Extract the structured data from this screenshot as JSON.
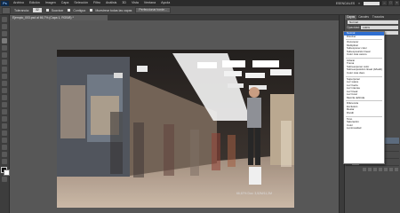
{
  "app": {
    "logo": "Ps"
  },
  "menu": [
    "Archivo",
    "Edición",
    "Imagen",
    "Capa",
    "Selección",
    "Filtro",
    "Análisis",
    "3D",
    "Vista",
    "Ventana",
    "Ayuda"
  ],
  "workspace": {
    "label": "ESENCIALES",
    "more": "»"
  },
  "window_buttons": [
    "–",
    "□",
    "×"
  ],
  "options": {
    "tolerance_label": "Tolerancia:",
    "tolerance_value": "32",
    "antialias_label": "Suavizar",
    "contiguous_label": "Contiguo",
    "all_layers_label": "Muestrear todas las capas",
    "refine_label": "Perfeccionar borde..."
  },
  "document": {
    "tab": "Ejemplo_003.psd al 66,7% (Capa 1, RGB/8) *",
    "close": "×"
  },
  "status": {
    "zoom": "66,67%",
    "doc": "Doc: 3,52M/11,2M"
  },
  "panel": {
    "tabs": [
      "Capas",
      "Canales",
      "Trazados"
    ],
    "mode_label": "Normal",
    "opacity_label": "Opacidad:",
    "opacity_value": "100%",
    "lock_label": "Bloq.:",
    "fill_label": "Relleno:",
    "fill_value": "100%"
  },
  "blend_menu": {
    "items": [
      "Normal",
      "Disolver",
      "Oscurecer",
      "Multiplicar",
      "Subexponer color",
      "Subexposición lineal",
      "Color más oscuro",
      "Aclarar",
      "Trama",
      "Sobreexponer color",
      "Sobreexposición lineal (Añadir)",
      "Color más claro",
      "Superponer",
      "Luz suave",
      "Luz fuerte",
      "Luz intensa",
      "Luz lineal",
      "Luz focal",
      "Mezcla definida",
      "Diferencia",
      "Exclusión",
      "Restar",
      "Dividir",
      "Tono",
      "Saturación",
      "Color",
      "Luminosidad"
    ],
    "highlight_index": 0,
    "groups": [
      2,
      5,
      5,
      7,
      4,
      4
    ]
  },
  "layers": [
    {
      "name": "Capa 1",
      "selected": true,
      "sub": false
    },
    {
      "name": "Efectos",
      "selected": false,
      "sub": true
    },
    {
      "name": "Sombra paralela",
      "selected": false,
      "sub": true
    },
    {
      "name": "Fondo",
      "selected": false,
      "sub": false
    }
  ],
  "colors": {
    "accent": "#2f6fd1",
    "panel": "#4a4a4a",
    "canvas": "#575757"
  }
}
